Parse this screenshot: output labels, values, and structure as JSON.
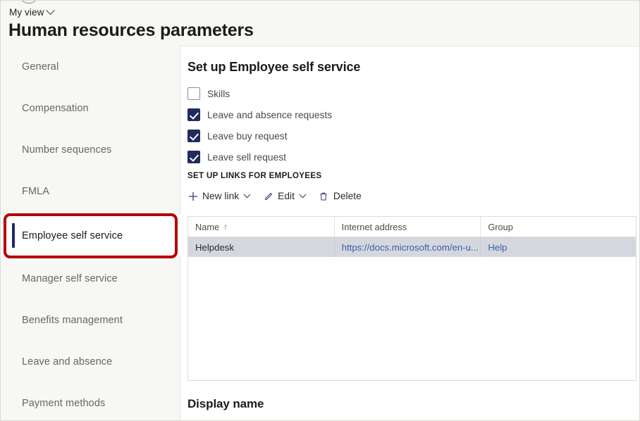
{
  "header": {
    "view_selector": "My view",
    "chevron_icon": "chevron-down-icon",
    "title": "Human resources parameters"
  },
  "sidebar": {
    "items": [
      {
        "label": "General",
        "selected": false
      },
      {
        "label": "Compensation",
        "selected": false
      },
      {
        "label": "Number sequences",
        "selected": false
      },
      {
        "label": "FMLA",
        "selected": false
      },
      {
        "label": "Employee self service",
        "selected": true
      },
      {
        "label": "Manager self service",
        "selected": false
      },
      {
        "label": "Benefits management",
        "selected": false
      },
      {
        "label": "Leave and absence",
        "selected": false
      },
      {
        "label": "Payment methods",
        "selected": false
      }
    ],
    "annotation_color": "#b60000",
    "accent_color": "#1f2a5e"
  },
  "main": {
    "section_title": "Set up Employee self service",
    "checkboxes": [
      {
        "label": "Skills",
        "checked": false
      },
      {
        "label": "Leave and absence requests",
        "checked": true
      },
      {
        "label": "Leave buy request",
        "checked": true
      },
      {
        "label": "Leave sell request",
        "checked": true
      }
    ],
    "subheading": "SET UP LINKS FOR EMPLOYEES",
    "toolbar": [
      {
        "label": "New link",
        "icon": "plus-icon",
        "has_chevron": true
      },
      {
        "label": "Edit",
        "icon": "pencil-icon",
        "has_chevron": true
      },
      {
        "label": "Delete",
        "icon": "trash-icon",
        "has_chevron": false
      }
    ],
    "grid": {
      "columns": [
        {
          "label": "Name",
          "sort": "↑"
        },
        {
          "label": "Internet address",
          "sort": ""
        },
        {
          "label": "Group",
          "sort": ""
        }
      ],
      "rows": [
        {
          "name": "Helpdesk",
          "internet_address": "https://docs.microsoft.com/en-u...",
          "group": "Help"
        }
      ]
    },
    "display_name_label": "Display name"
  },
  "colors": {
    "checkbox_checked": "#202c5c",
    "link": "#3b5fa8",
    "row_selected": "#d4d7de",
    "sidebar_bg": "#f7f7f4"
  }
}
